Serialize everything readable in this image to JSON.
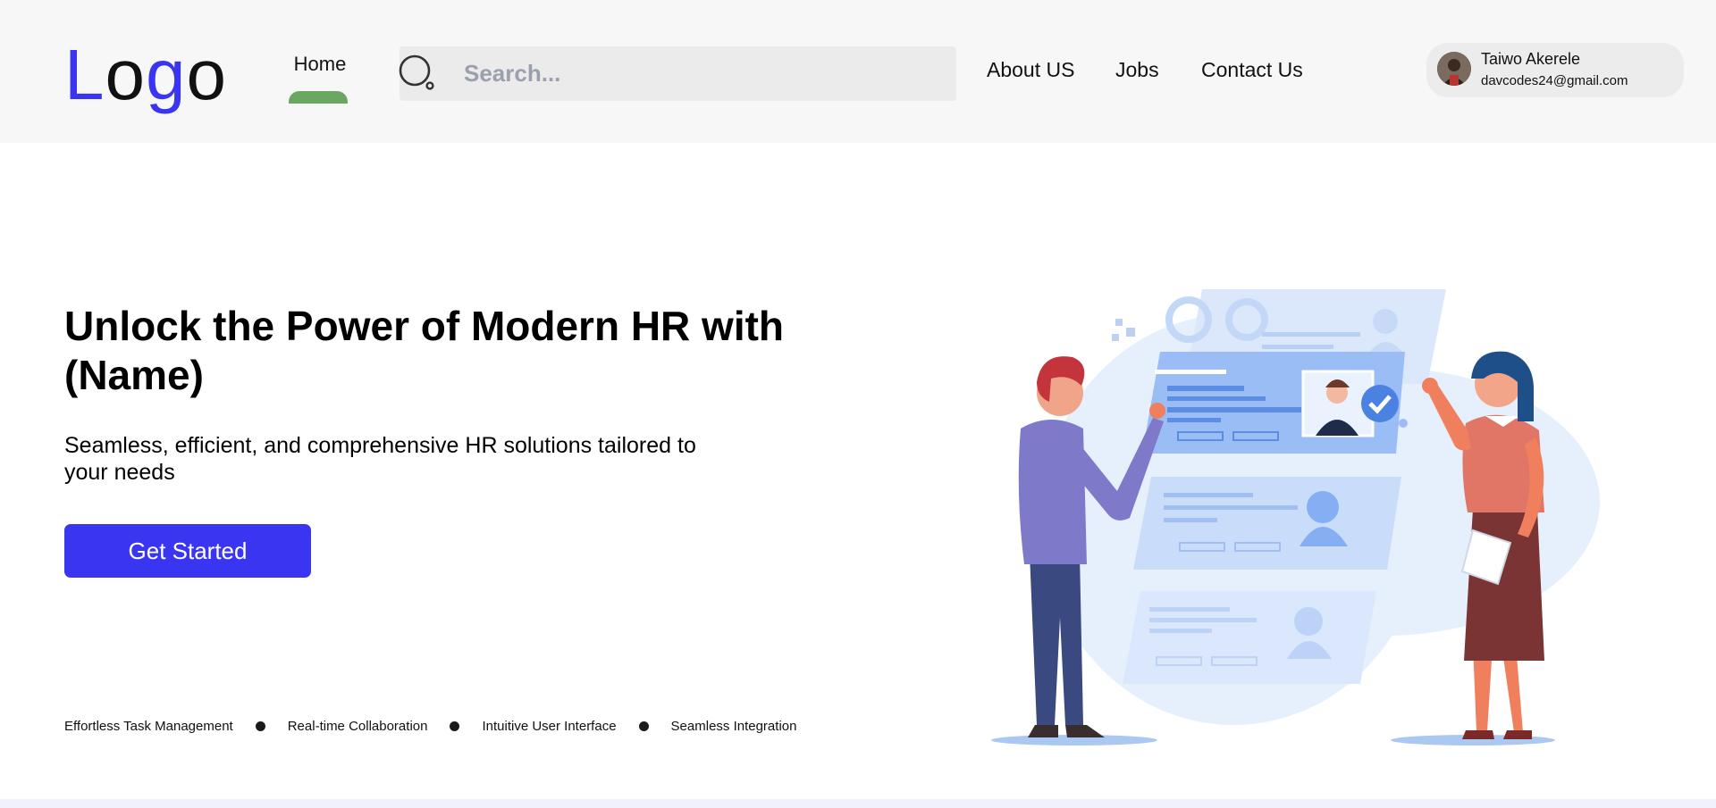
{
  "header": {
    "logo": {
      "letters": [
        "L",
        "o",
        "g",
        "o"
      ],
      "colors": [
        "#3a35f0",
        "#111111",
        "#3a35f0",
        "#111111"
      ]
    },
    "nav": {
      "home": "Home",
      "about": "About US",
      "jobs": "Jobs",
      "contact": "Contact Us"
    },
    "search": {
      "placeholder": "Search...",
      "value": ""
    },
    "user": {
      "name": "Taiwo Akerele",
      "email": "davcodes24@gmail.com"
    }
  },
  "hero": {
    "title": "Unlock the Power of Modern HR with (Name)",
    "subtitle": "Seamless, efficient, and comprehensive HR solutions tailored to your needs",
    "cta": "Get Started",
    "features": [
      "Effortless Task Management",
      "Real-time Collaboration",
      "Intuitive User Interface",
      "Seamless Integration"
    ]
  },
  "colors": {
    "primary": "#3a35f0",
    "active_indicator": "#6aa861",
    "header_bg": "#f7f7f7",
    "search_bg": "#ebebeb"
  }
}
